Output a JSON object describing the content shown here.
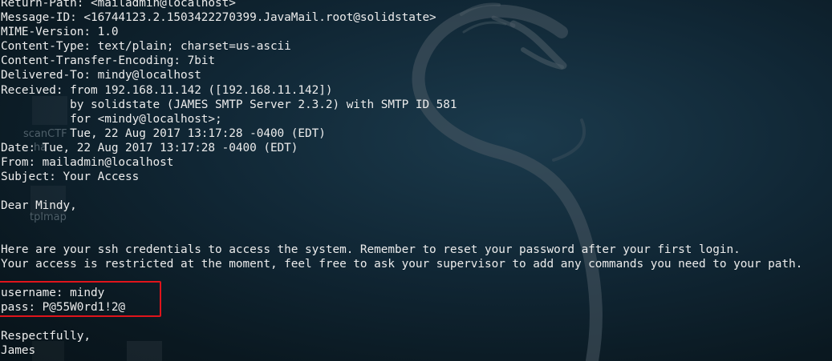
{
  "desktop": {
    "icon_labels": [
      "scanCTF",
      "ha",
      "tplmap"
    ],
    "colors": {
      "background": "#0d1e28",
      "dragon": "#4a5a64",
      "terminal_text": "#ececec",
      "highlight_box": "#e0141b"
    }
  },
  "email": {
    "lines": [
      "Return-Path: <mailadmin@localhost>",
      "Message-ID: <16744123.2.1503422270399.JavaMail.root@solidstate>",
      "MIME-Version: 1.0",
      "Content-Type: text/plain; charset=us-ascii",
      "Content-Transfer-Encoding: 7bit",
      "Delivered-To: mindy@localhost",
      "Received: from 192.168.11.142 ([192.168.11.142])",
      "          by solidstate (JAMES SMTP Server 2.3.2) with SMTP ID 581",
      "          for <mindy@localhost>;",
      "          Tue, 22 Aug 2017 13:17:28 -0400 (EDT)",
      "Date: Tue, 22 Aug 2017 13:17:28 -0400 (EDT)",
      "From: mailadmin@localhost",
      "Subject: Your Access",
      "",
      "Dear Mindy,",
      "",
      "",
      "Here are your ssh credentials to access the system. Remember to reset your password after your first login.",
      "Your access is restricted at the moment, feel free to ask your supervisor to add any commands you need to your path.",
      "",
      "username: mindy",
      "pass: P@55W0rd1!2@",
      "",
      "Respectfully,",
      "James"
    ]
  }
}
